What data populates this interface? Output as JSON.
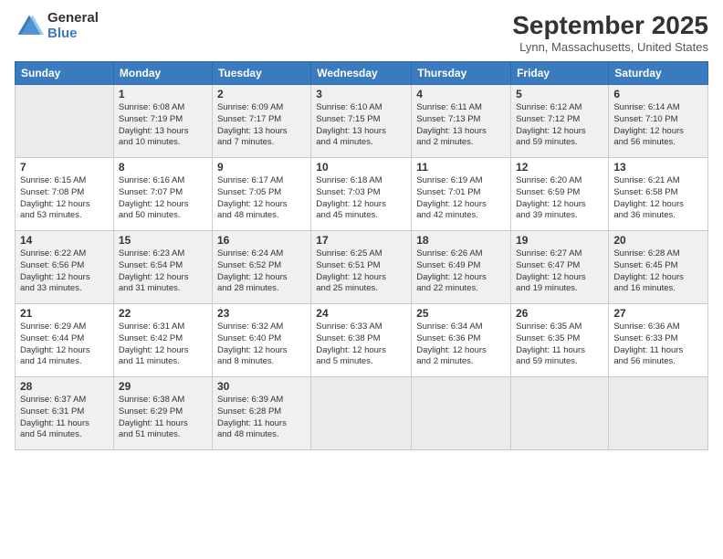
{
  "logo": {
    "general": "General",
    "blue": "Blue"
  },
  "header": {
    "title": "September 2025",
    "location": "Lynn, Massachusetts, United States"
  },
  "columns": [
    "Sunday",
    "Monday",
    "Tuesday",
    "Wednesday",
    "Thursday",
    "Friday",
    "Saturday"
  ],
  "weeks": [
    [
      {
        "num": "",
        "info": ""
      },
      {
        "num": "1",
        "info": "Sunrise: 6:08 AM\nSunset: 7:19 PM\nDaylight: 13 hours\nand 10 minutes."
      },
      {
        "num": "2",
        "info": "Sunrise: 6:09 AM\nSunset: 7:17 PM\nDaylight: 13 hours\nand 7 minutes."
      },
      {
        "num": "3",
        "info": "Sunrise: 6:10 AM\nSunset: 7:15 PM\nDaylight: 13 hours\nand 4 minutes."
      },
      {
        "num": "4",
        "info": "Sunrise: 6:11 AM\nSunset: 7:13 PM\nDaylight: 13 hours\nand 2 minutes."
      },
      {
        "num": "5",
        "info": "Sunrise: 6:12 AM\nSunset: 7:12 PM\nDaylight: 12 hours\nand 59 minutes."
      },
      {
        "num": "6",
        "info": "Sunrise: 6:14 AM\nSunset: 7:10 PM\nDaylight: 12 hours\nand 56 minutes."
      }
    ],
    [
      {
        "num": "7",
        "info": "Sunrise: 6:15 AM\nSunset: 7:08 PM\nDaylight: 12 hours\nand 53 minutes."
      },
      {
        "num": "8",
        "info": "Sunrise: 6:16 AM\nSunset: 7:07 PM\nDaylight: 12 hours\nand 50 minutes."
      },
      {
        "num": "9",
        "info": "Sunrise: 6:17 AM\nSunset: 7:05 PM\nDaylight: 12 hours\nand 48 minutes."
      },
      {
        "num": "10",
        "info": "Sunrise: 6:18 AM\nSunset: 7:03 PM\nDaylight: 12 hours\nand 45 minutes."
      },
      {
        "num": "11",
        "info": "Sunrise: 6:19 AM\nSunset: 7:01 PM\nDaylight: 12 hours\nand 42 minutes."
      },
      {
        "num": "12",
        "info": "Sunrise: 6:20 AM\nSunset: 6:59 PM\nDaylight: 12 hours\nand 39 minutes."
      },
      {
        "num": "13",
        "info": "Sunrise: 6:21 AM\nSunset: 6:58 PM\nDaylight: 12 hours\nand 36 minutes."
      }
    ],
    [
      {
        "num": "14",
        "info": "Sunrise: 6:22 AM\nSunset: 6:56 PM\nDaylight: 12 hours\nand 33 minutes."
      },
      {
        "num": "15",
        "info": "Sunrise: 6:23 AM\nSunset: 6:54 PM\nDaylight: 12 hours\nand 31 minutes."
      },
      {
        "num": "16",
        "info": "Sunrise: 6:24 AM\nSunset: 6:52 PM\nDaylight: 12 hours\nand 28 minutes."
      },
      {
        "num": "17",
        "info": "Sunrise: 6:25 AM\nSunset: 6:51 PM\nDaylight: 12 hours\nand 25 minutes."
      },
      {
        "num": "18",
        "info": "Sunrise: 6:26 AM\nSunset: 6:49 PM\nDaylight: 12 hours\nand 22 minutes."
      },
      {
        "num": "19",
        "info": "Sunrise: 6:27 AM\nSunset: 6:47 PM\nDaylight: 12 hours\nand 19 minutes."
      },
      {
        "num": "20",
        "info": "Sunrise: 6:28 AM\nSunset: 6:45 PM\nDaylight: 12 hours\nand 16 minutes."
      }
    ],
    [
      {
        "num": "21",
        "info": "Sunrise: 6:29 AM\nSunset: 6:44 PM\nDaylight: 12 hours\nand 14 minutes."
      },
      {
        "num": "22",
        "info": "Sunrise: 6:31 AM\nSunset: 6:42 PM\nDaylight: 12 hours\nand 11 minutes."
      },
      {
        "num": "23",
        "info": "Sunrise: 6:32 AM\nSunset: 6:40 PM\nDaylight: 12 hours\nand 8 minutes."
      },
      {
        "num": "24",
        "info": "Sunrise: 6:33 AM\nSunset: 6:38 PM\nDaylight: 12 hours\nand 5 minutes."
      },
      {
        "num": "25",
        "info": "Sunrise: 6:34 AM\nSunset: 6:36 PM\nDaylight: 12 hours\nand 2 minutes."
      },
      {
        "num": "26",
        "info": "Sunrise: 6:35 AM\nSunset: 6:35 PM\nDaylight: 11 hours\nand 59 minutes."
      },
      {
        "num": "27",
        "info": "Sunrise: 6:36 AM\nSunset: 6:33 PM\nDaylight: 11 hours\nand 56 minutes."
      }
    ],
    [
      {
        "num": "28",
        "info": "Sunrise: 6:37 AM\nSunset: 6:31 PM\nDaylight: 11 hours\nand 54 minutes."
      },
      {
        "num": "29",
        "info": "Sunrise: 6:38 AM\nSunset: 6:29 PM\nDaylight: 11 hours\nand 51 minutes."
      },
      {
        "num": "30",
        "info": "Sunrise: 6:39 AM\nSunset: 6:28 PM\nDaylight: 11 hours\nand 48 minutes."
      },
      {
        "num": "",
        "info": ""
      },
      {
        "num": "",
        "info": ""
      },
      {
        "num": "",
        "info": ""
      },
      {
        "num": "",
        "info": ""
      }
    ]
  ]
}
